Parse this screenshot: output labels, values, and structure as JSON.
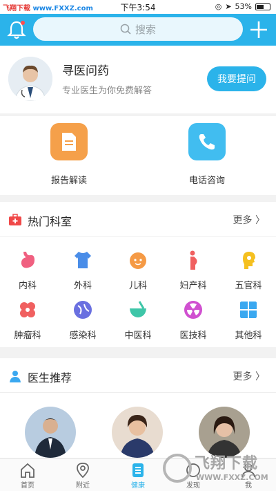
{
  "status": {
    "watermark_a": "飞翔下载",
    "watermark_b": "www.FXXZ.com",
    "time": "下午3:54",
    "battery": "53%"
  },
  "topbar": {
    "search_placeholder": "搜索",
    "bell_icon": "bell-icon",
    "plus_icon": "plus-icon"
  },
  "ask": {
    "title": "寻医问药",
    "subtitle": "专业医生为你免费解答",
    "button": "我要提问"
  },
  "services": [
    {
      "label": "报告解读",
      "icon": "report-doc-icon",
      "color": "#f5a04a"
    },
    {
      "label": "电话咨询",
      "icon": "phone-icon",
      "color": "#41bdf0"
    }
  ],
  "departments": {
    "title": "热门科室",
    "more": "更多",
    "items": [
      {
        "label": "内科",
        "icon": "stomach-icon",
        "color": "#f06080"
      },
      {
        "label": "外科",
        "icon": "shirt-icon",
        "color": "#4a8de8"
      },
      {
        "label": "儿科",
        "icon": "baby-face-icon",
        "color": "#f59a45"
      },
      {
        "label": "妇产科",
        "icon": "pregnant-icon",
        "color": "#f06060"
      },
      {
        "label": "五官科",
        "icon": "head-profile-icon",
        "color": "#f5c020"
      },
      {
        "label": "肿瘤科",
        "icon": "cells-icon",
        "color": "#f06060"
      },
      {
        "label": "感染科",
        "icon": "virus-icon",
        "color": "#6a70e0"
      },
      {
        "label": "中医科",
        "icon": "mortar-icon",
        "color": "#3ec6a8"
      },
      {
        "label": "医技科",
        "icon": "radiation-icon",
        "color": "#d050d0"
      },
      {
        "label": "其他科",
        "icon": "grid-icon",
        "color": "#3aa8f0"
      }
    ]
  },
  "recommend": {
    "title": "医生推荐",
    "more": "更多"
  },
  "tabs": [
    {
      "label": "首页",
      "icon": "home-icon"
    },
    {
      "label": "附近",
      "icon": "location-pin-icon"
    },
    {
      "label": "健康",
      "icon": "health-doc-icon"
    },
    {
      "label": "发现",
      "icon": "discover-icon"
    },
    {
      "label": "我",
      "icon": "user-icon"
    }
  ],
  "footer_watermark": {
    "title": "飞翔下载",
    "url": "WWW.FXXZ.COM"
  },
  "colors": {
    "accent": "#2bb3ea"
  }
}
